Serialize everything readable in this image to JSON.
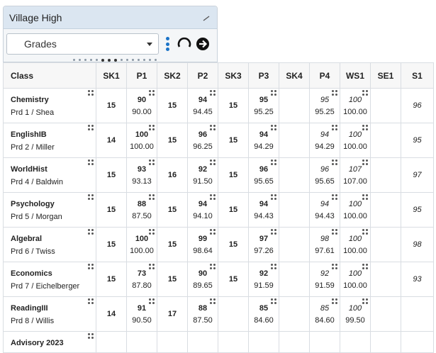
{
  "panel": {
    "title": "Village High",
    "select_value": "Grades"
  },
  "table": {
    "headers": [
      "Class",
      "SK1",
      "P1",
      "SK2",
      "P2",
      "SK3",
      "P3",
      "SK4",
      "P4",
      "WS1",
      "SE1",
      "S1"
    ],
    "rows": [
      {
        "name": "Chemistry",
        "period": "Prd 1 / Shea",
        "sk1": "15",
        "p1": [
          "90",
          "90.00"
        ],
        "sk2": "15",
        "p2": [
          "94",
          "94.45"
        ],
        "sk3": "15",
        "p3": [
          "95",
          "95.25"
        ],
        "sk4": "",
        "p4": [
          "95",
          "95.25"
        ],
        "ws1": [
          "100",
          "100.00"
        ],
        "se1": "",
        "s1": "96"
      },
      {
        "name": "EnglishIB",
        "period": "Prd 2 / Miller",
        "sk1": "14",
        "p1": [
          "100",
          "100.00"
        ],
        "sk2": "15",
        "p2": [
          "96",
          "96.25"
        ],
        "sk3": "15",
        "p3": [
          "94",
          "94.29"
        ],
        "sk4": "",
        "p4": [
          "94",
          "94.29"
        ],
        "ws1": [
          "100",
          "100.00"
        ],
        "se1": "",
        "s1": "95"
      },
      {
        "name": "WorldHist",
        "period": "Prd 4 / Baldwin",
        "sk1": "15",
        "p1": [
          "93",
          "93.13"
        ],
        "sk2": "16",
        "p2": [
          "92",
          "91.50"
        ],
        "sk3": "15",
        "p3": [
          "96",
          "95.65"
        ],
        "sk4": "",
        "p4": [
          "96",
          "95.65"
        ],
        "ws1": [
          "107",
          "107.00"
        ],
        "se1": "",
        "s1": "97"
      },
      {
        "name": "Psychology",
        "period": "Prd 5 / Morgan",
        "sk1": "15",
        "p1": [
          "88",
          "87.50"
        ],
        "sk2": "15",
        "p2": [
          "94",
          "94.10"
        ],
        "sk3": "15",
        "p3": [
          "94",
          "94.43"
        ],
        "sk4": "",
        "p4": [
          "94",
          "94.43"
        ],
        "ws1": [
          "100",
          "100.00"
        ],
        "se1": "",
        "s1": "95"
      },
      {
        "name": "Algebral",
        "period": "Prd 6 / Twiss",
        "sk1": "15",
        "p1": [
          "100",
          "100.00"
        ],
        "sk2": "15",
        "p2": [
          "99",
          "98.64"
        ],
        "sk3": "15",
        "p3": [
          "97",
          "97.26"
        ],
        "sk4": "",
        "p4": [
          "98",
          "97.61"
        ],
        "ws1": [
          "100",
          "100.00"
        ],
        "se1": "",
        "s1": "98"
      },
      {
        "name": "Economics",
        "period": "Prd 7 / Eichelberger",
        "sk1": "15",
        "p1": [
          "73",
          "87.80"
        ],
        "sk2": "15",
        "p2": [
          "90",
          "89.65"
        ],
        "sk3": "15",
        "p3": [
          "92",
          "91.59"
        ],
        "sk4": "",
        "p4": [
          "92",
          "91.59"
        ],
        "ws1": [
          "100",
          "100.00"
        ],
        "se1": "",
        "s1": "93"
      },
      {
        "name": "ReadingIII",
        "period": "Prd 8 / Willis",
        "sk1": "14",
        "p1": [
          "91",
          "90.50"
        ],
        "sk2": "17",
        "p2": [
          "88",
          "87.50"
        ],
        "sk3": "",
        "p3": [
          "85",
          "84.60"
        ],
        "sk4": "",
        "p4": [
          "85",
          "84.60"
        ],
        "ws1": [
          "100",
          "99.50"
        ],
        "se1": "",
        "s1": ""
      }
    ],
    "advisory_label": "Advisory 2023"
  },
  "colors": {
    "accent": "#1a73c8",
    "title_bar": "#dbe6f1",
    "grid": "#d9dde2"
  }
}
